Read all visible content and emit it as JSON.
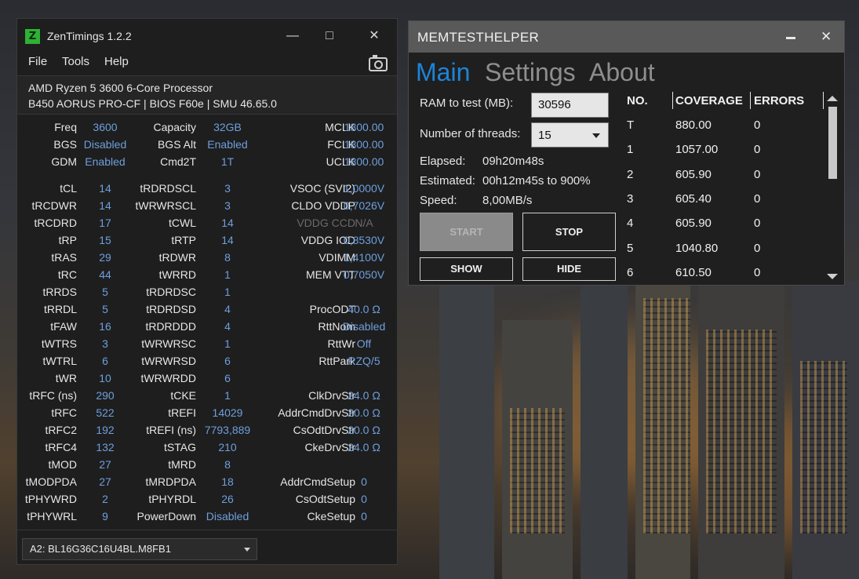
{
  "zentimings": {
    "title": "ZenTimings 1.2.2",
    "logo_letter": "Z",
    "menu": [
      "File",
      "Tools",
      "Help"
    ],
    "cpu": "AMD Ryzen 5 3600 6-Core Processor",
    "board": "B450 AORUS PRO-CF | BIOS F60e | SMU 46.65.0",
    "rows": [
      {
        "l1": "Freq",
        "v1": "3600",
        "l2": "Capacity",
        "v2": "32GB",
        "l3": "MCLK",
        "v3": "1800.00"
      },
      {
        "l1": "BGS",
        "v1": "Disabled",
        "l2": "BGS Alt",
        "v2": "Enabled",
        "l3": "FCLK",
        "v3": "1800.00"
      },
      {
        "l1": "GDM",
        "v1": "Enabled",
        "l2": "Cmd2T",
        "v2": "1T",
        "l3": "UCLK",
        "v3": "1800.00"
      },
      {
        "l1": "tCL",
        "v1": "14",
        "l2": "tRDRDSCL",
        "v2": "3",
        "l3": "VSOC (SVI2)",
        "v3": "1,0000V"
      },
      {
        "l1": "tRCDWR",
        "v1": "14",
        "l2": "tWRWRSCL",
        "v2": "3",
        "l3": "CLDO VDDP",
        "v3": "0,7026V"
      },
      {
        "l1": "tRCDRD",
        "v1": "17",
        "l2": "tCWL",
        "v2": "14",
        "l3": "VDDG CCD",
        "v3": "N/A"
      },
      {
        "l1": "tRP",
        "v1": "15",
        "l2": "tRTP",
        "v2": "14",
        "l3": "VDDG IOD",
        "v3": "0,8530V"
      },
      {
        "l1": "tRAS",
        "v1": "29",
        "l2": "tRDWR",
        "v2": "8",
        "l3": "VDIMM",
        "v3": "1,4100V"
      },
      {
        "l1": "tRC",
        "v1": "44",
        "l2": "tWRRD",
        "v2": "1",
        "l3": "MEM VTT",
        "v3": "0,7050V"
      },
      {
        "l1": "tRRDS",
        "v1": "5",
        "l2": "tRDRDSC",
        "v2": "1",
        "l3": "",
        "v3": ""
      },
      {
        "l1": "tRRDL",
        "v1": "5",
        "l2": "tRDRDSD",
        "v2": "4",
        "l3": "ProcODT",
        "v3": "40.0 Ω"
      },
      {
        "l1": "tFAW",
        "v1": "16",
        "l2": "tRDRDDD",
        "v2": "4",
        "l3": "RttNom",
        "v3": "Disabled"
      },
      {
        "l1": "tWTRS",
        "v1": "3",
        "l2": "tWRWRSC",
        "v2": "1",
        "l3": "RttWr",
        "v3": "Off"
      },
      {
        "l1": "tWTRL",
        "v1": "6",
        "l2": "tWRWRSD",
        "v2": "6",
        "l3": "RttPark",
        "v3": "RZQ/5"
      },
      {
        "l1": "tWR",
        "v1": "10",
        "l2": "tWRWRDD",
        "v2": "6",
        "l3": "",
        "v3": ""
      },
      {
        "l1": "tRFC (ns)",
        "v1": "290",
        "l2": "tCKE",
        "v2": "1",
        "l3": "ClkDrvStr",
        "v3": "24.0 Ω"
      },
      {
        "l1": "tRFC",
        "v1": "522",
        "l2": "tREFI",
        "v2": "14029",
        "l3": "AddrCmdDrvStr",
        "v3": "20.0 Ω"
      },
      {
        "l1": "tRFC2",
        "v1": "192",
        "l2": "tREFI (ns)",
        "v2": "7793,889",
        "l3": "CsOdtDrvStr",
        "v3": "20.0 Ω"
      },
      {
        "l1": "tRFC4",
        "v1": "132",
        "l2": "tSTAG",
        "v2": "210",
        "l3": "CkeDrvStr",
        "v3": "24.0 Ω"
      },
      {
        "l1": "tMOD",
        "v1": "27",
        "l2": "tMRD",
        "v2": "8",
        "l3": "",
        "v3": ""
      },
      {
        "l1": "tMODPDA",
        "v1": "27",
        "l2": "tMRDPDA",
        "v2": "18",
        "l3": "AddrCmdSetup",
        "v3": "0"
      },
      {
        "l1": "tPHYWRD",
        "v1": "2",
        "l2": "tPHYRDL",
        "v2": "26",
        "l3": "CsOdtSetup",
        "v3": "0"
      },
      {
        "l1": "tPHYWRL",
        "v1": "9",
        "l2": "PowerDown",
        "v2": "Disabled",
        "l3": "CkeSetup",
        "v3": "0"
      }
    ],
    "dimm": "A2: BL16G36C16U4BL.M8FB1"
  },
  "memtest": {
    "title": "MEMTESTHELPER",
    "tabs": [
      "Main",
      "Settings",
      "About"
    ],
    "ram_label": "RAM to test (MB):",
    "ram_value": "30596",
    "threads_label": "Number of threads:",
    "threads_value": "15",
    "elapsed_label": "Elapsed:",
    "elapsed_value": "09h20m48s",
    "estimated_label": "Estimated:",
    "estimated_value": "00h12m45s to 900%",
    "speed_label": "Speed:",
    "speed_value": "8,00MB/s",
    "buttons": {
      "start": "START",
      "stop": "STOP",
      "show": "SHOW",
      "hide": "HIDE"
    },
    "table_headers": [
      "NO.",
      "COVERAGE",
      "ERRORS"
    ],
    "table_rows": [
      {
        "no": "T",
        "coverage": "880.00",
        "errors": "0"
      },
      {
        "no": "1",
        "coverage": "1057.00",
        "errors": "0"
      },
      {
        "no": "2",
        "coverage": "605.90",
        "errors": "0"
      },
      {
        "no": "3",
        "coverage": "605.40",
        "errors": "0"
      },
      {
        "no": "4",
        "coverage": "605.90",
        "errors": "0"
      },
      {
        "no": "5",
        "coverage": "1040.80",
        "errors": "0"
      },
      {
        "no": "6",
        "coverage": "610.50",
        "errors": "0"
      }
    ],
    "colors": {
      "active_tab": "#1e84d8",
      "inactive_tab": "#8e8e8e"
    }
  }
}
